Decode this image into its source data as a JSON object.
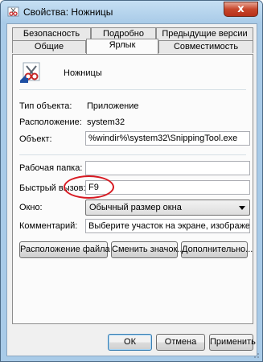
{
  "window": {
    "title": "Свойства: Ножницы",
    "close_label": "x"
  },
  "tabs": {
    "row1": [
      "Безопасность",
      "Подробно",
      "Предыдущие версии"
    ],
    "row2": [
      "Общие",
      "Ярлык",
      "Совместимость"
    ],
    "active": "Ярлык"
  },
  "shortcut": {
    "app_name": "Ножницы",
    "type_label": "Тип объекта:",
    "type_value": "Приложение",
    "location_label": "Расположение:",
    "location_value": "system32",
    "target_label": "Объект:",
    "target_value": "%windir%\\system32\\SnippingTool.exe",
    "workdir_label": "Рабочая папка:",
    "workdir_value": "",
    "hotkey_label": "Быстрый вызов:",
    "hotkey_value": "F9",
    "window_label": "Окно:",
    "window_value": "Обычный размер окна",
    "comment_label": "Комментарий:",
    "comment_value": "Выберите участок на экране, изображение ко"
  },
  "buttons": {
    "open_location": "Расположение файла",
    "change_icon": "Сменить значок...",
    "advanced": "Дополнительно...",
    "ok": "ОК",
    "cancel": "Отмена",
    "apply": "Применить"
  },
  "colors": {
    "highlight_oval": "#d71921",
    "window_frame": "#a9cbe8"
  }
}
